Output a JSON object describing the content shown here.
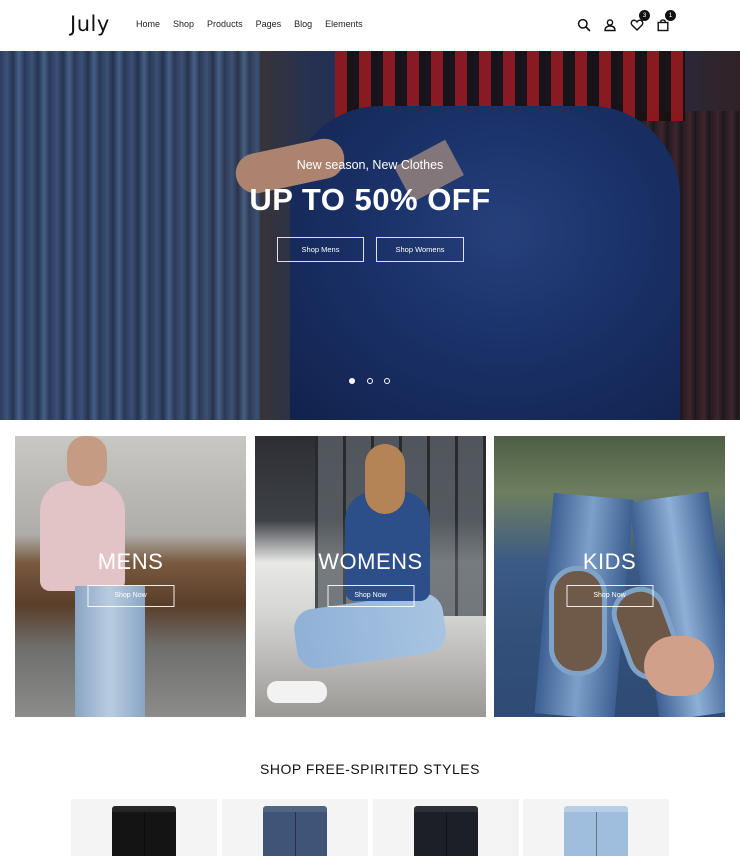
{
  "header": {
    "logo": "July",
    "nav": [
      "Home",
      "Shop",
      "Products",
      "Pages",
      "Blog",
      "Elements"
    ],
    "icons": [
      "search-icon",
      "user-icon",
      "heart-icon",
      "bag-icon"
    ],
    "wishlist_count": "3",
    "cart_count": "1"
  },
  "hero": {
    "subtitle": "New season, New Clothes",
    "title": "UP TO 50% OFF",
    "buttons": [
      "Shop Mens",
      "Shop Womens"
    ],
    "slides_total": 3,
    "slide_active": 1
  },
  "categories": [
    {
      "label": "MENS",
      "button": "Shop Now"
    },
    {
      "label": "WOMENS",
      "button": "Shop Now"
    },
    {
      "label": "KIDS",
      "button": "Shop Now"
    }
  ],
  "section": {
    "title": "SHOP FREE-SPIRITED STYLES",
    "products": [
      {
        "color": "#141414"
      },
      {
        "color": "#3e5578"
      },
      {
        "color": "#1c1f28"
      },
      {
        "color": "#9fbede"
      }
    ]
  }
}
